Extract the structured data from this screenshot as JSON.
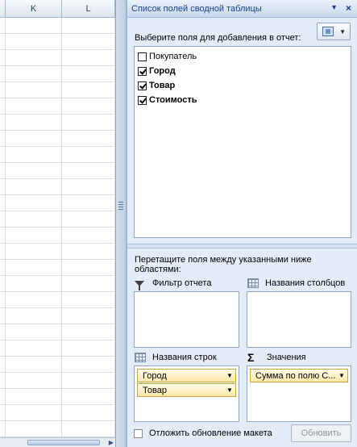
{
  "sheet": {
    "columns": [
      "K",
      "L"
    ]
  },
  "pane": {
    "title": "Список полей сводной таблицы",
    "prompt": "Выберите поля для добавления в отчет:",
    "fields": [
      {
        "label": "Покупатель",
        "checked": false,
        "bold": false
      },
      {
        "label": "Город",
        "checked": true,
        "bold": true
      },
      {
        "label": "Товар",
        "checked": true,
        "bold": true
      },
      {
        "label": "Стоимость",
        "checked": true,
        "bold": true
      }
    ],
    "drag_hint": "Перетащите поля между указанными ниже областями:",
    "areas": {
      "report_filter": {
        "label": "Фильтр отчета",
        "icon": "filter-icon",
        "items": []
      },
      "column_labels": {
        "label": "Названия столбцов",
        "icon": "grid-icon",
        "items": []
      },
      "row_labels": {
        "label": "Названия строк",
        "icon": "grid-icon",
        "items": [
          "Город",
          "Товар"
        ]
      },
      "values": {
        "label": "Значения",
        "icon": "sigma-icon",
        "items": [
          "Сумма по полю С..."
        ]
      }
    },
    "defer_update": {
      "label": "Отложить обновление макета",
      "checked": false
    },
    "update_button": "Обновить"
  },
  "colors": {
    "pane_background": "#e3ecf7",
    "title_text": "#15428b",
    "chip_border": "#c9a33d",
    "chip_fill": "#fde9a8"
  }
}
